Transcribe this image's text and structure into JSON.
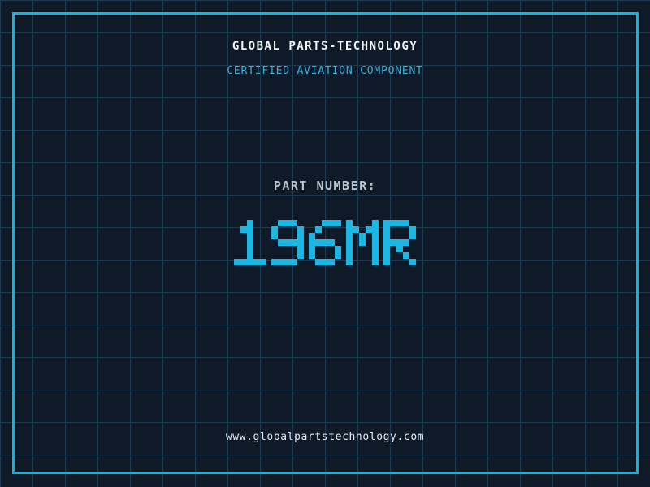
{
  "header": {
    "title": "GLOBAL PARTS-TECHNOLOGY",
    "subtitle": "CERTIFIED AVIATION COMPONENT"
  },
  "part": {
    "label": "PART NUMBER:",
    "number": "196MR"
  },
  "footer": {
    "website": "www.globalpartstechnology.com"
  },
  "colors": {
    "background_navy": "#0f1a28",
    "grid_line": "#1e3a50",
    "border_cyan": "#0cb4e0",
    "accent_cyan": "#19b7e2",
    "subtitle_cyan": "#35b2de",
    "title_white": "#f4f7f9",
    "label_gray": "#b9c4ce"
  }
}
